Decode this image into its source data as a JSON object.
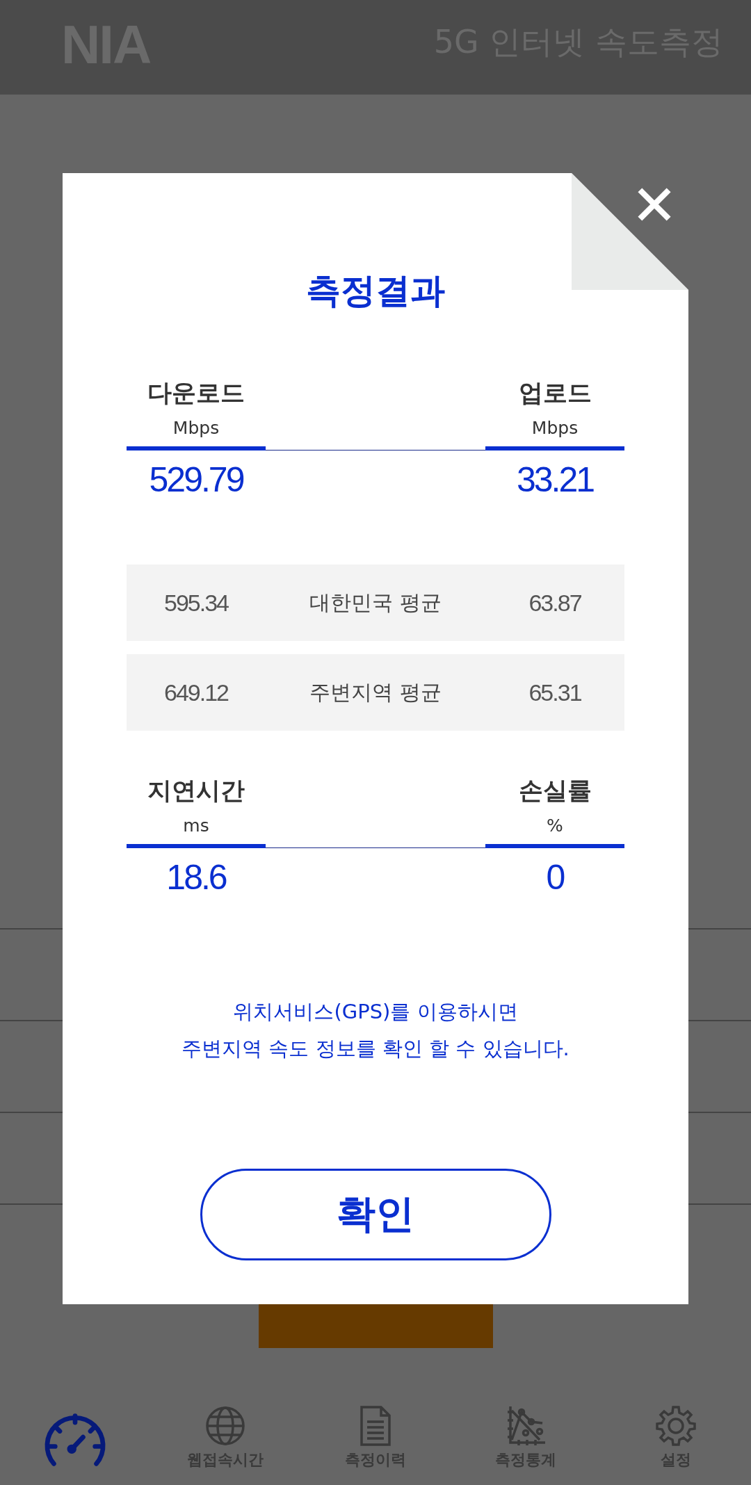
{
  "header": {
    "logo": "NIA",
    "title": "5G 인터넷 속도측정"
  },
  "dialog": {
    "title": "측정결과",
    "primary": [
      {
        "label": "다운로드",
        "unit": "Mbps",
        "value": "529.79"
      },
      {
        "label": "업로드",
        "unit": "Mbps",
        "value": "33.21"
      }
    ],
    "averages": [
      {
        "download": "595.34",
        "label": "대한민국 평균",
        "upload": "63.87"
      },
      {
        "download": "649.12",
        "label": "주변지역 평균",
        "upload": "65.31"
      }
    ],
    "secondary": [
      {
        "label": "지연시간",
        "unit": "ms",
        "value": "18.6"
      },
      {
        "label": "손실률",
        "unit": "%",
        "value": "0"
      }
    ],
    "notice": [
      "위치서비스(GPS)를 이용하시면",
      "주변지역 속도 정보를 확인 할 수 있습니다."
    ],
    "confirm": "확인"
  },
  "nav": [
    {
      "selected": true
    },
    {
      "label": "웹접속시간",
      "selected": false
    },
    {
      "label": "측정이력",
      "selected": false
    },
    {
      "label": "측정통계",
      "selected": false
    },
    {
      "label": "설정",
      "selected": false
    }
  ]
}
